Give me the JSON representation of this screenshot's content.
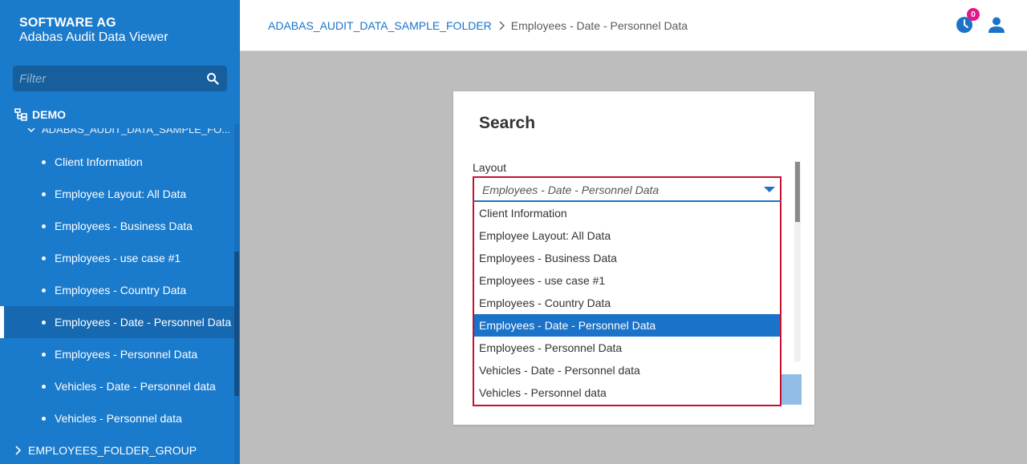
{
  "app": {
    "brand_title": "SOFTWARE AG",
    "brand_subtitle": "Adabas Audit Data Viewer"
  },
  "sidebar": {
    "filter_placeholder": "Filter",
    "root_label": "DEMO",
    "folder_label": "ADABAS_AUDIT_DATA_SAMPLE_FO...",
    "items": [
      {
        "label": "Client Information"
      },
      {
        "label": "Employee Layout: All Data"
      },
      {
        "label": "Employees - Business Data"
      },
      {
        "label": "Employees - use case #1"
      },
      {
        "label": "Employees - Country Data"
      },
      {
        "label": "Employees - Date - Personnel Data",
        "active": true
      },
      {
        "label": "Employees - Personnel Data"
      },
      {
        "label": "Vehicles - Date - Personnel data"
      },
      {
        "label": "Vehicles - Personnel data"
      }
    ],
    "group_label": "EMPLOYEES_FOLDER_GROUP"
  },
  "header": {
    "breadcrumb": {
      "folder": "ADABAS_AUDIT_DATA_SAMPLE_FOLDER",
      "separator": "›",
      "current": "Employees - Date - Personnel Data"
    },
    "notification_count": "0"
  },
  "search": {
    "title": "Search",
    "layout_label": "Layout",
    "layout_value": "Employees - Date - Personnel Data",
    "options": [
      "Client Information",
      "Employee Layout: All Data",
      "Employees - Business Data",
      "Employees - use case #1",
      "Employees - Country Data",
      "Employees - Date - Personnel Data",
      "Employees - Personnel Data",
      "Vehicles - Date - Personnel data",
      "Vehicles - Personnel data"
    ],
    "selected_index": 5
  },
  "colors": {
    "sidebar_bg": "#1a7acb",
    "accent": "#1a73c8",
    "badge": "#e2178a",
    "highlight_border": "#c8102e"
  },
  "icons": {
    "search": "search-icon",
    "tree": "tree-icon",
    "history": "history-icon",
    "user": "user-icon"
  }
}
